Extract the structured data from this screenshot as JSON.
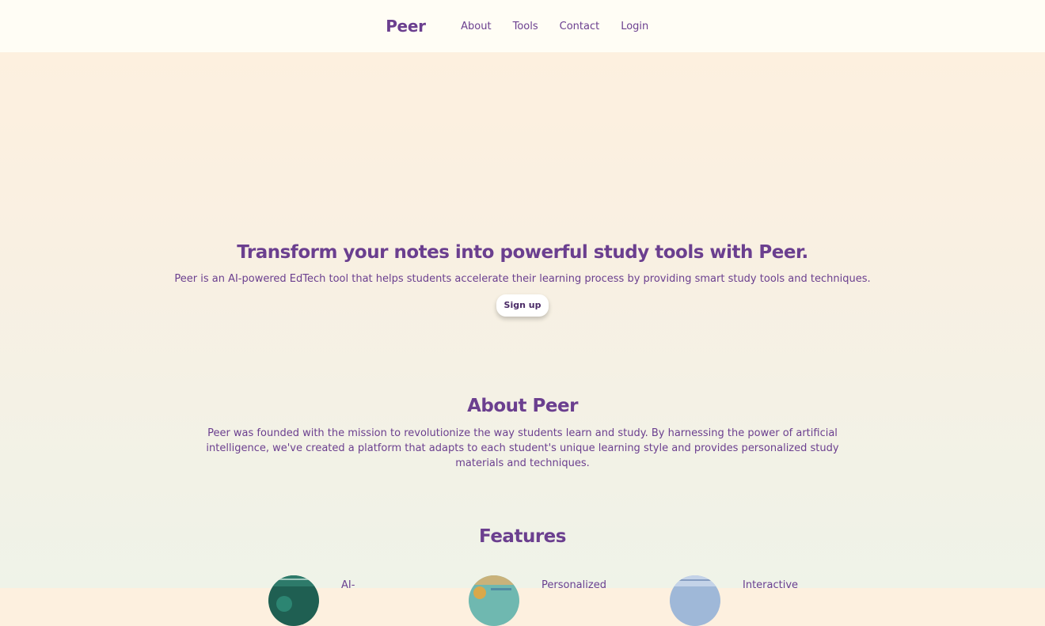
{
  "nav": {
    "brand": "Peer",
    "links": [
      "About",
      "Tools",
      "Contact",
      "Login"
    ]
  },
  "hero": {
    "title": "Transform your notes into powerful study tools with Peer.",
    "subtitle": "Peer is an AI-powered EdTech tool that helps students accelerate their learning process by providing smart study tools and techniques.",
    "cta_label": "Sign up"
  },
  "about": {
    "title": "About Peer",
    "text": "Peer was founded with the mission to revolutionize the way students learn and study. By harnessing the power of artificial intelligence, we've created a platform that adapts to each student's unique learning style and provides personalized study materials and techniques."
  },
  "features": {
    "title": "Features",
    "items": [
      {
        "title": "AI-",
        "thumb_color": "#1f5f52"
      },
      {
        "title": "Personalized",
        "thumb_color": "#6fb8b0"
      },
      {
        "title": "Interactive",
        "thumb_color": "#9fb8d8"
      }
    ]
  },
  "colors": {
    "accent": "#6b3f8f",
    "nav_bg": "#fffdf5",
    "button_bg": "#ffffff"
  }
}
